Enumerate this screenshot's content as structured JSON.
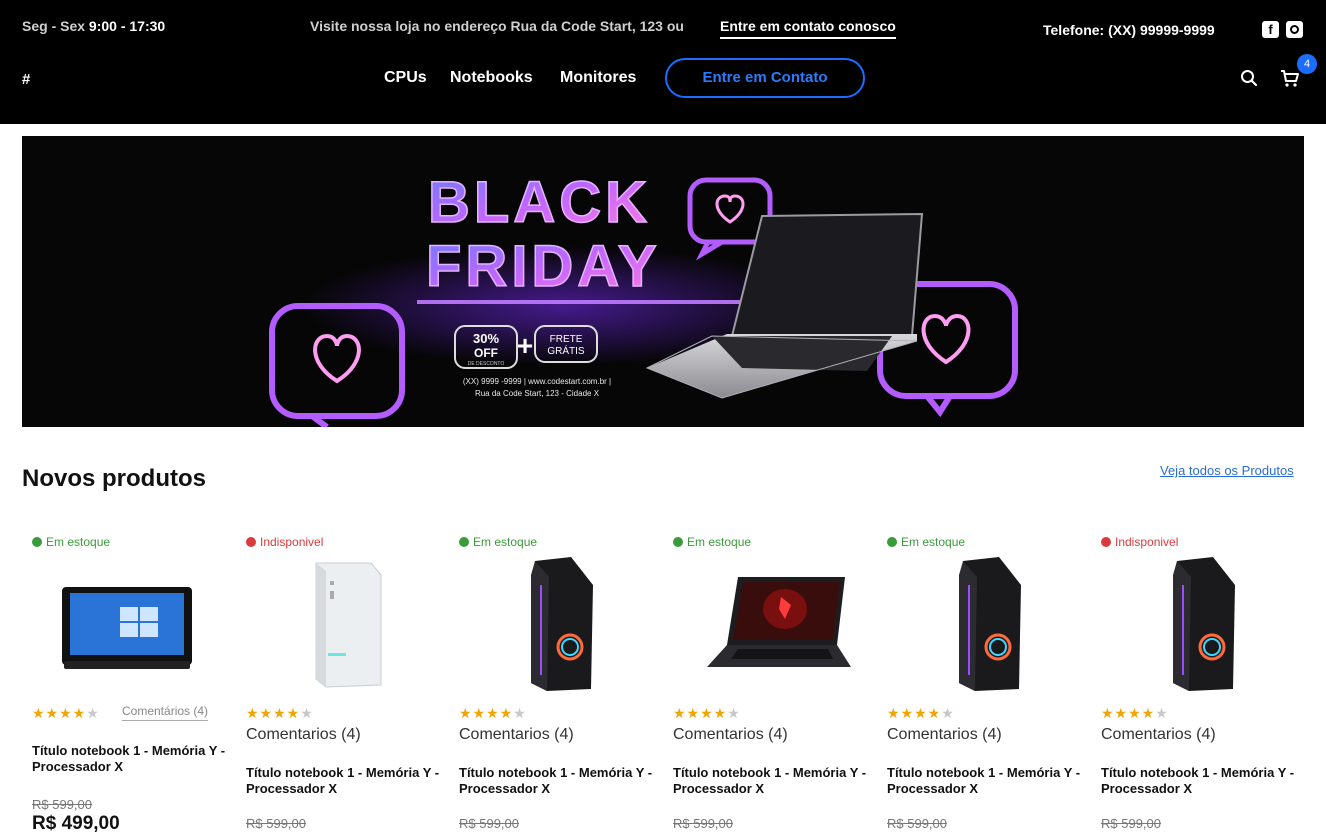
{
  "topbar": {
    "hours_prefix": "Seg - Sex",
    "hours_value": "9:00 - 17:30",
    "visit_text": "Visite nossa loja no endereço Rua da Code Start, 123 ou",
    "contact_link": "Entre em contato conosco",
    "phone": "Telefone: (XX) 99999-9999",
    "social": {
      "facebook_icon": "facebook-icon",
      "instagram_icon": "instagram-icon"
    }
  },
  "navbar": {
    "hash": "#",
    "items": [
      "CPUs",
      "Notebooks",
      "Monitores"
    ],
    "cta": "Entre em Contato",
    "cart_count": "4"
  },
  "banner": {
    "line1": "BLACK",
    "line2": "FRIDAY",
    "discount": "30%",
    "discount_off": "OFF",
    "discount_sub": "DE DESCONTO",
    "plus": "+",
    "frete1": "FRETE",
    "frete2": "GRÁTIS",
    "contact_line1": "(XX) 9999 -9999 | www.codestart.com.br |",
    "contact_line2": "Rua da Code Start, 123 - Cidade X"
  },
  "section": {
    "title": "Novos produtos",
    "see_all": "Veja todos os Produtos"
  },
  "products": [
    {
      "stock": "Em estoque",
      "stars": "★★★★",
      "star_off": "★",
      "comments": "Comentários (4)",
      "title": "Título notebook 1 - Memória Y - Processador X",
      "old_price": "R$ 599,00",
      "new_price": "R$ 499,00"
    },
    {
      "stock": "Indisponivel",
      "stars": "★★★★",
      "star_off": "★",
      "comments": "Comentarios (4)",
      "title": "Título notebook 1 - Memória Y - Processador X",
      "old_price": "R$ 599,00"
    },
    {
      "stock": "Em estoque",
      "stars": "★★★★",
      "star_off": "★",
      "comments": "Comentarios (4)",
      "title": "Título notebook 1 - Memória Y - Processador X",
      "old_price": "R$ 599,00"
    },
    {
      "stock": "Em estoque",
      "stars": "★★★★",
      "star_off": "★",
      "comments": "Comentarios (4)",
      "title": "Título notebook 1 - Memória Y - Processador X",
      "old_price": "R$ 599,00"
    },
    {
      "stock": "Em estoque",
      "stars": "★★★★",
      "star_off": "★",
      "comments": "Comentarios (4)",
      "title": "Título notebook 1 - Memória Y - Processador X",
      "old_price": "R$ 599,00"
    },
    {
      "stock": "Indisponivel",
      "stars": "★★★★",
      "star_off": "★",
      "comments": "Comentarios (4)",
      "title": "Título notebook 1 - Memória Y - Processador X",
      "old_price": "R$ 599,00"
    }
  ],
  "colors": {
    "accent": "#1a6dff",
    "in_stock": "#3a9b3a",
    "out_of_stock": "#d93b3b",
    "star": "#f0a500",
    "neon_purple": "#a640ff"
  }
}
